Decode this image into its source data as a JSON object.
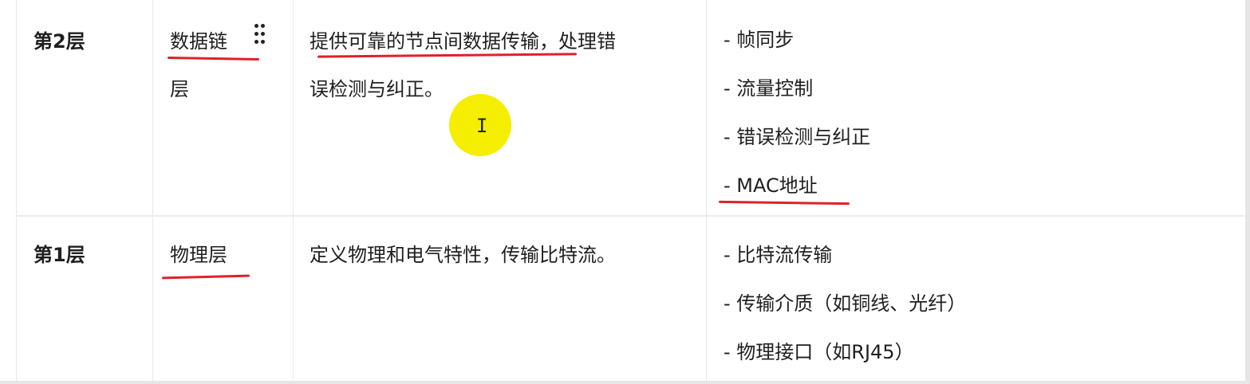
{
  "rows": [
    {
      "layer": "第2层",
      "name_line1": "数据链",
      "name_line2": "层",
      "desc_line1": "提供可靠的节点间数据传输，处理错",
      "desc_line2": "误检测与纠正。",
      "functions": [
        "- 帧同步",
        "- 流量控制",
        "- 错误检测与纠正",
        "- MAC地址"
      ]
    },
    {
      "layer": "第1层",
      "name_line1": "物理层",
      "desc_line1": "定义物理和电气特性，传输比特流。",
      "functions": [
        "- 比特流传输",
        "- 传输介质（如铜线、光纤）",
        "- 物理接口（如RJ45）"
      ]
    }
  ],
  "annotation_color": "#e0202a",
  "cursor_highlight_color": "#f5ee00"
}
